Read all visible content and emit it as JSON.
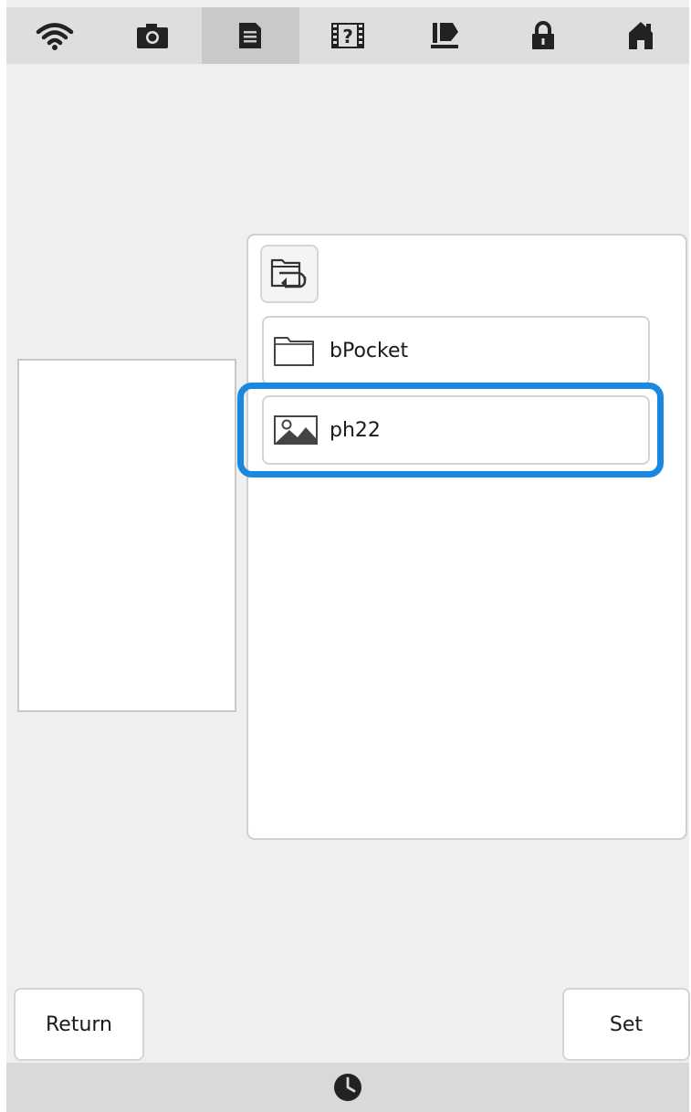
{
  "toolbar": {
    "items": [
      {
        "icon": "wifi-icon"
      },
      {
        "icon": "camera-icon"
      },
      {
        "icon": "document-icon",
        "active": true
      },
      {
        "icon": "help-film-icon",
        "text": "?"
      },
      {
        "icon": "presser-foot-icon"
      },
      {
        "icon": "lock-icon"
      },
      {
        "icon": "home-icon"
      }
    ]
  },
  "file_browser": {
    "back_icon": "folder-back-icon",
    "items": [
      {
        "label": "bPocket",
        "type": "folder",
        "icon": "folder-icon"
      },
      {
        "label": "ph22",
        "type": "image",
        "icon": "image-icon",
        "selected": true
      }
    ]
  },
  "buttons": {
    "return_label": "Return",
    "set_label": "Set"
  },
  "status_bar": {
    "icon": "clock-icon"
  },
  "colors": {
    "highlight": "#1a87e0",
    "background": "#efefef",
    "toolbar": "#dedede",
    "active_tab": "#c9c9c9"
  }
}
